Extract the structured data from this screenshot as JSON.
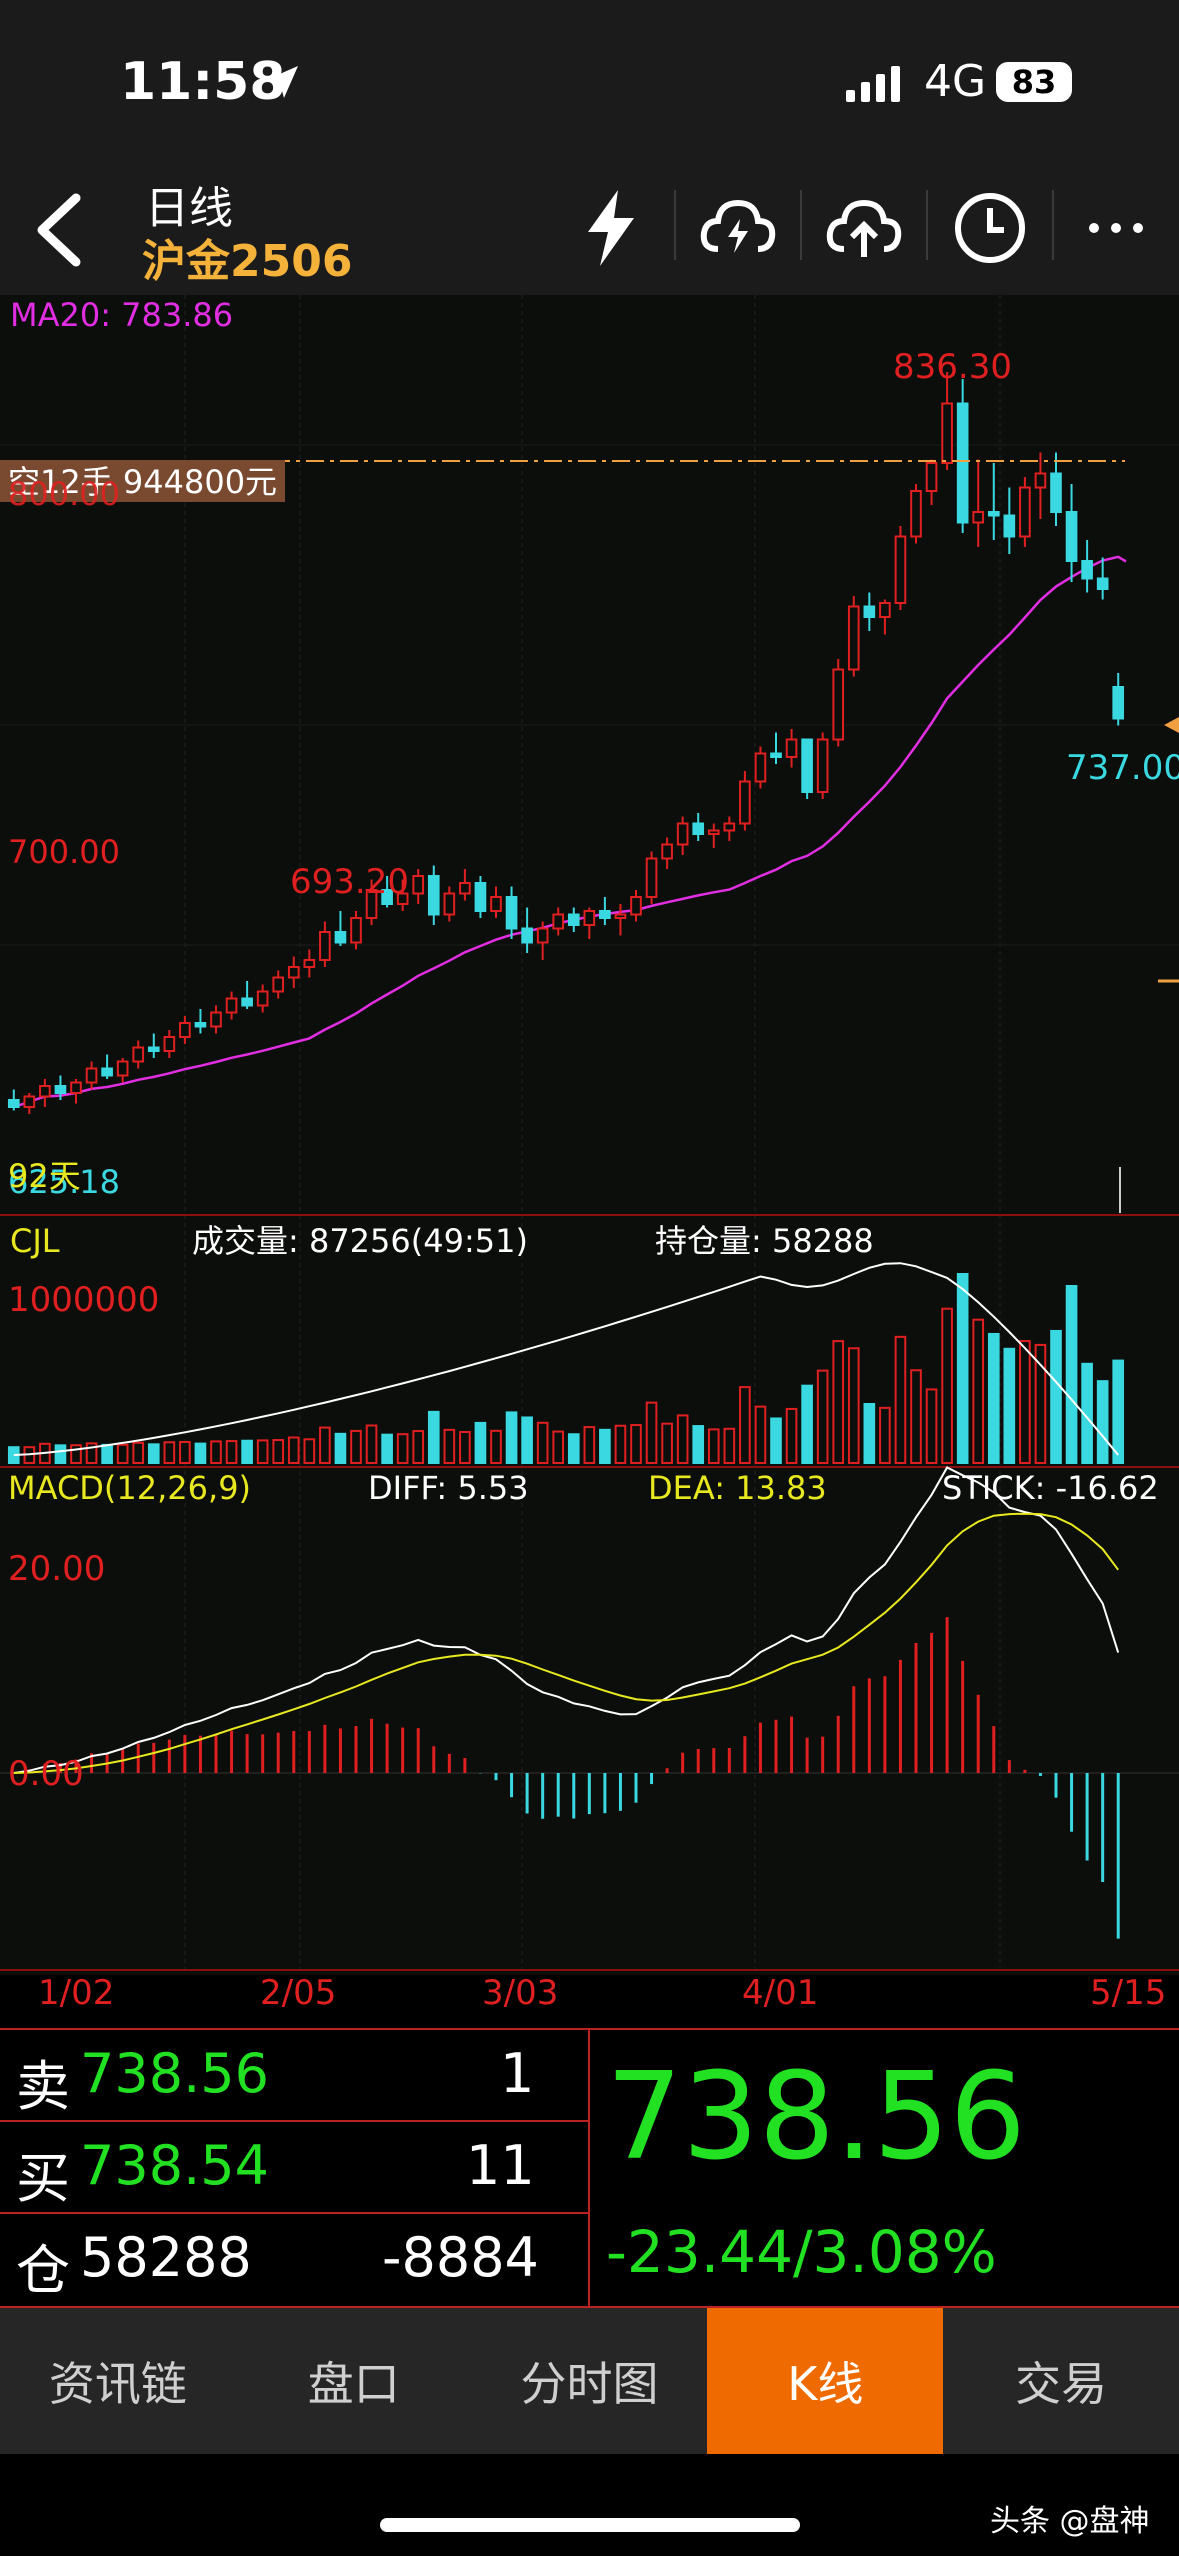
{
  "status_bar": {
    "time": "11:58",
    "network": "4G",
    "battery": "83"
  },
  "header": {
    "title": "日线",
    "subtitle": "沪金2506"
  },
  "chart_data": {
    "type": "candlestick",
    "ma_label": "MA20: 783.86",
    "position_tag": "空12手 944800元",
    "price_labels": [
      "800.00",
      "700.00"
    ],
    "high_label": "836.30",
    "mid_high_label": "693.20",
    "last_label": "737.00",
    "low_left_label": "92天",
    "low_left_value": "625.18",
    "volume_panel": {
      "title": "CJL",
      "volume": "成交量: 87256(49:51)",
      "open_interest": "持仓量: 58288",
      "axis_label": "1000000"
    },
    "macd_panel": {
      "title": "MACD(12,26,9)",
      "diff": "DIFF: 5.53",
      "dea": "DEA: 13.83",
      "stick": "STICK: -16.62",
      "axis_top": "20.00",
      "axis_zero": "0.00"
    },
    "x_labels": [
      "1/02",
      "2/05",
      "3/03",
      "4/01",
      "5/15"
    ],
    "candles": [
      [
        630,
        633,
        627,
        628
      ],
      [
        628,
        632,
        626,
        631
      ],
      [
        631,
        636,
        628,
        634
      ],
      [
        634,
        637,
        630,
        632
      ],
      [
        632,
        636,
        629,
        635
      ],
      [
        635,
        641,
        633,
        639
      ],
      [
        639,
        643,
        636,
        637
      ],
      [
        637,
        642,
        635,
        641
      ],
      [
        641,
        647,
        639,
        645
      ],
      [
        645,
        649,
        642,
        644
      ],
      [
        644,
        650,
        642,
        648
      ],
      [
        648,
        654,
        646,
        652
      ],
      [
        652,
        656,
        649,
        651
      ],
      [
        651,
        657,
        649,
        655
      ],
      [
        655,
        661,
        653,
        659
      ],
      [
        659,
        664,
        656,
        657
      ],
      [
        657,
        663,
        655,
        661
      ],
      [
        661,
        667,
        659,
        665
      ],
      [
        665,
        671,
        662,
        668
      ],
      [
        668,
        673,
        665,
        670
      ],
      [
        670,
        681,
        668,
        678
      ],
      [
        678,
        684,
        674,
        675
      ],
      [
        675,
        684,
        673,
        682
      ],
      [
        682,
        693,
        680,
        690
      ],
      [
        690,
        694,
        685,
        686
      ],
      [
        686,
        693,
        684,
        689
      ],
      [
        689,
        696,
        686,
        694
      ],
      [
        694,
        697,
        680,
        683
      ],
      [
        683,
        691,
        681,
        689
      ],
      [
        689,
        696,
        687,
        692
      ],
      [
        692,
        694,
        682,
        684
      ],
      [
        684,
        691,
        682,
        688
      ],
      [
        688,
        691,
        676,
        679
      ],
      [
        679,
        685,
        672,
        675
      ],
      [
        675,
        681,
        670,
        679
      ],
      [
        679,
        685,
        677,
        683
      ],
      [
        683,
        685,
        678,
        680
      ],
      [
        680,
        685,
        676,
        684
      ],
      [
        684,
        688,
        680,
        682
      ],
      [
        682,
        686,
        677,
        683
      ],
      [
        683,
        690,
        681,
        688
      ],
      [
        688,
        701,
        686,
        699
      ],
      [
        699,
        705,
        696,
        703
      ],
      [
        703,
        711,
        700,
        709
      ],
      [
        709,
        712,
        704,
        706
      ],
      [
        706,
        709,
        702,
        707
      ],
      [
        707,
        711,
        704,
        709
      ],
      [
        709,
        724,
        707,
        721
      ],
      [
        721,
        731,
        719,
        729
      ],
      [
        729,
        735,
        726,
        728
      ],
      [
        728,
        736,
        725,
        733
      ],
      [
        733,
        732,
        716,
        718
      ],
      [
        718,
        735,
        716,
        733
      ],
      [
        733,
        756,
        731,
        753
      ],
      [
        753,
        774,
        751,
        771
      ],
      [
        771,
        775,
        764,
        768
      ],
      [
        768,
        773,
        763,
        772
      ],
      [
        772,
        794,
        770,
        791
      ],
      [
        791,
        806,
        789,
        804
      ],
      [
        804,
        813,
        800,
        812
      ],
      [
        812,
        838,
        810,
        829
      ],
      [
        829,
        836,
        792,
        795
      ],
      [
        795,
        813,
        788,
        798
      ],
      [
        798,
        812,
        790,
        797
      ],
      [
        797,
        805,
        786,
        791
      ],
      [
        791,
        808,
        788,
        805
      ],
      [
        805,
        815,
        796,
        809
      ],
      [
        809,
        815,
        794,
        798
      ],
      [
        798,
        806,
        778,
        784
      ],
      [
        784,
        790,
        775,
        779
      ],
      [
        779,
        785,
        773,
        776
      ],
      [
        748,
        752,
        737,
        739
      ]
    ]
  },
  "quote": {
    "sell_label": "卖",
    "sell_price": "738.56",
    "sell_qty": "1",
    "buy_label": "买",
    "buy_price": "738.54",
    "buy_qty": "11",
    "pos_label": "仓",
    "pos_value": "58288",
    "pos_change": "-8884",
    "last_price": "738.56",
    "change": "-23.44/3.08%"
  },
  "tabs": [
    "资讯链",
    "盘口",
    "分时图",
    "K线",
    "交易"
  ],
  "watermark": "头条 @盘神"
}
